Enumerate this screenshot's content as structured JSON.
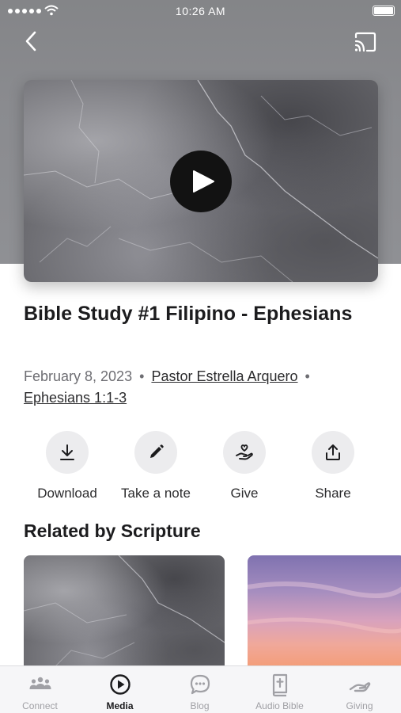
{
  "status_bar": {
    "time": "10:26 AM"
  },
  "header": {
    "back_icon": "chevron-left-icon",
    "cast_icon": "cast-icon"
  },
  "video": {
    "play_icon": "play-icon"
  },
  "sermon": {
    "title": "Bible Study #1 Filipino - Ephesians",
    "date": "February 8, 2023",
    "speaker": "Pastor Estrella Arquero",
    "scripture": "Ephesians 1:1-3",
    "separator": "•"
  },
  "actions": [
    {
      "label": "Download",
      "icon": "download-icon"
    },
    {
      "label": "Take a note",
      "icon": "pencil-icon"
    },
    {
      "label": "Give",
      "icon": "give-hand-heart-icon"
    },
    {
      "label": "Share",
      "icon": "share-icon"
    }
  ],
  "related": {
    "title": "Related by Scripture"
  },
  "tabs": [
    {
      "label": "Connect",
      "icon": "people-icon",
      "active": false
    },
    {
      "label": "Media",
      "icon": "play-circle-icon",
      "active": true
    },
    {
      "label": "Blog",
      "icon": "chat-bubble-icon",
      "active": false
    },
    {
      "label": "Audio Bible",
      "icon": "bible-icon",
      "active": false
    },
    {
      "label": "Giving",
      "icon": "giving-hand-icon",
      "active": false
    }
  ],
  "colors": {
    "header_gray": "#8a8b8f",
    "active_tab": "#1c1c1e",
    "inactive_tab": "#a0a0a5"
  }
}
